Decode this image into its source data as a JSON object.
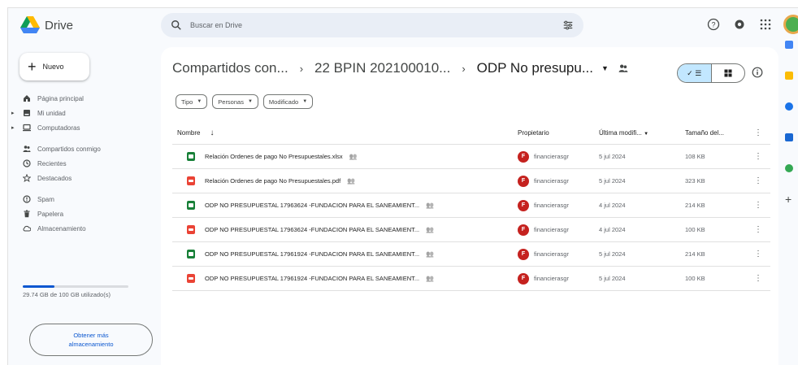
{
  "app": {
    "name": "Drive"
  },
  "search": {
    "placeholder": "Buscar en Drive"
  },
  "sidebar": {
    "new_label": "Nuevo",
    "items": [
      {
        "label": "Página principal",
        "icon": "home-icon"
      },
      {
        "label": "Mi unidad",
        "icon": "drive-icon"
      },
      {
        "label": "Computadoras",
        "icon": "computer-icon"
      },
      {
        "label": "Compartidos conmigo",
        "icon": "people-icon"
      },
      {
        "label": "Recientes",
        "icon": "clock-icon"
      },
      {
        "label": "Destacados",
        "icon": "star-icon"
      },
      {
        "label": "Spam",
        "icon": "spam-icon"
      },
      {
        "label": "Papelera",
        "icon": "trash-icon"
      },
      {
        "label": "Almacenamiento",
        "icon": "cloud-icon"
      }
    ],
    "storage_text": "29.74 GB de 100 GB utilizado(s)",
    "storage_used_fraction": 0.2974,
    "get_storage_line1": "Obtener más",
    "get_storage_line2": "almacenamiento"
  },
  "breadcrumb": {
    "items": [
      "Compartidos con...",
      "22 BPIN 202100010...",
      "ODP No presupu..."
    ]
  },
  "filters": [
    "Tipo",
    "Personas",
    "Modificado"
  ],
  "table": {
    "headers": {
      "name": "Nombre",
      "owner": "Propietario",
      "modified": "Última modifi...",
      "size": "Tamaño del..."
    },
    "rows": [
      {
        "name": "Relación Ordenes de pago No Presupuestales.xlsx",
        "type": "xlsx",
        "owner": "financierasgr",
        "owner_initial": "F",
        "modified": "5 jul 2024",
        "size": "108 KB"
      },
      {
        "name": "Relación Ordenes de pago No Presupuestales.pdf",
        "type": "pdf",
        "owner": "financierasgr",
        "owner_initial": "F",
        "modified": "5 jul 2024",
        "size": "323 KB"
      },
      {
        "name": "ODP NO PRESUPUESTAL 17963624 -FUNDACION PARA EL SANEAMIENT...",
        "type": "xlsx",
        "owner": "financierasgr",
        "owner_initial": "F",
        "modified": "4 jul 2024",
        "size": "214 KB"
      },
      {
        "name": "ODP NO PRESUPUESTAL 17963624 -FUNDACION PARA EL SANEAMIENT...",
        "type": "pdf",
        "owner": "financierasgr",
        "owner_initial": "F",
        "modified": "4 jul 2024",
        "size": "100 KB"
      },
      {
        "name": "ODP NO PRESUPUESTAL 17961924 -FUNDACION PARA EL SANEAMIENT...",
        "type": "xlsx",
        "owner": "financierasgr",
        "owner_initial": "F",
        "modified": "5 jul 2024",
        "size": "214 KB"
      },
      {
        "name": "ODP NO PRESUPUESTAL 17961924 -FUNDACION PARA EL SANEAMIENT...",
        "type": "pdf",
        "owner": "financierasgr",
        "owner_initial": "F",
        "modified": "5 jul 2024",
        "size": "100 KB"
      }
    ]
  },
  "colors": {
    "accent": "#0b57d0",
    "xlsx": "#188038",
    "pdf": "#ea4335",
    "toggle_on": "#c2e7ff"
  }
}
